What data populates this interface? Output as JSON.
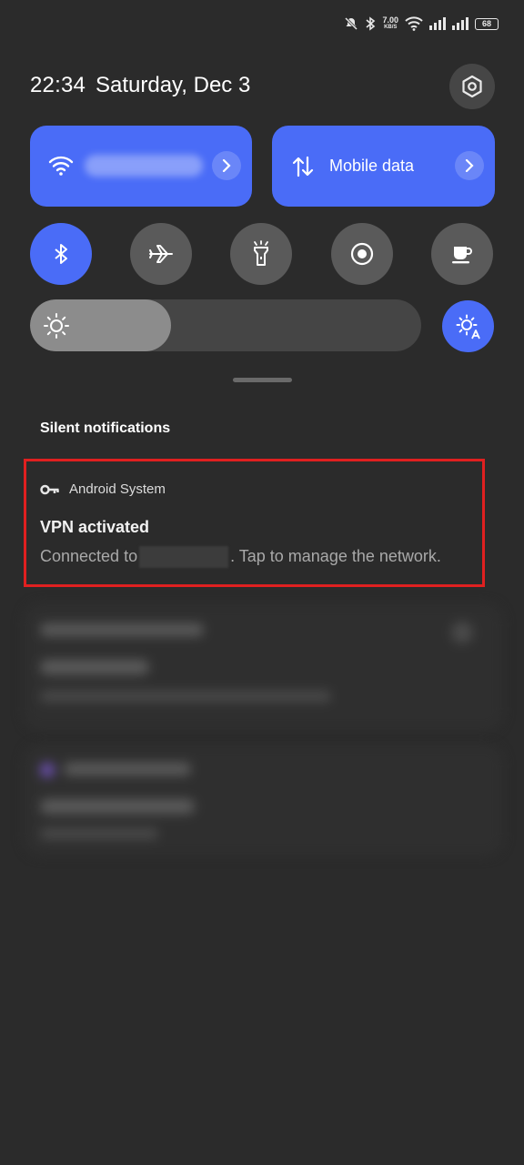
{
  "status_bar": {
    "net_speed_value": "7.00",
    "net_speed_unit": "KB/S",
    "battery": "68",
    "icons": [
      "mute-icon",
      "bluetooth-icon",
      "wifi-icon",
      "signal-icon",
      "signal-icon-2",
      "battery-icon"
    ]
  },
  "header": {
    "time": "22:34",
    "date": "Saturday, Dec 3"
  },
  "quick_tiles": {
    "wifi_icon": "wifi-icon",
    "mobile_data_label": "Mobile data"
  },
  "toggles": [
    {
      "name": "bluetooth",
      "active": true
    },
    {
      "name": "airplane-mode",
      "active": false
    },
    {
      "name": "flashlight",
      "active": false
    },
    {
      "name": "screen-record",
      "active": false
    },
    {
      "name": "caffeine",
      "active": false
    }
  ],
  "brightness": {
    "level": 0.36
  },
  "notifications": {
    "section_title": "Silent notifications",
    "vpn": {
      "app": "Android System",
      "title": "VPN activated",
      "body_prefix": "Connected to",
      "body_suffix": ". Tap to manage the network."
    }
  },
  "colors": {
    "accent": "#4a6cf7",
    "background": "#2b2b2b",
    "highlight": "#e02020"
  }
}
